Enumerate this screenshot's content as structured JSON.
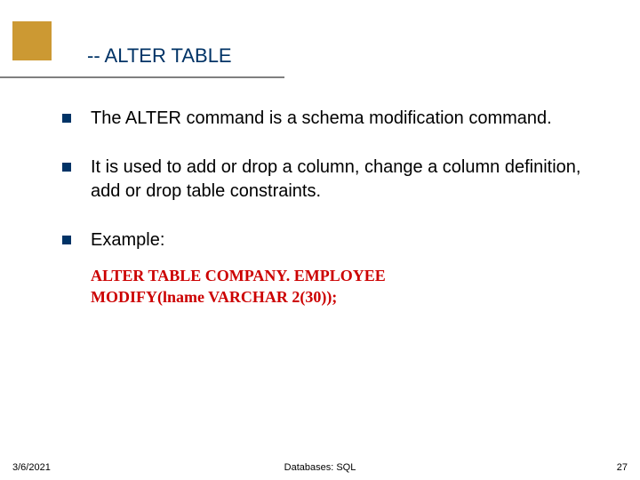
{
  "title": "-- ALTER TABLE",
  "bullets": [
    "The ALTER command is a schema modification command.",
    "It is used to add or drop a column, change a column definition, add or drop table constraints.",
    "Example:"
  ],
  "example": {
    "line1": "ALTER TABLE COMPANY. EMPLOYEE",
    "line2": "MODIFY(lname VARCHAR 2(30));"
  },
  "footer": {
    "date": "3/6/2021",
    "center": "Databases: SQL",
    "page": "27"
  }
}
